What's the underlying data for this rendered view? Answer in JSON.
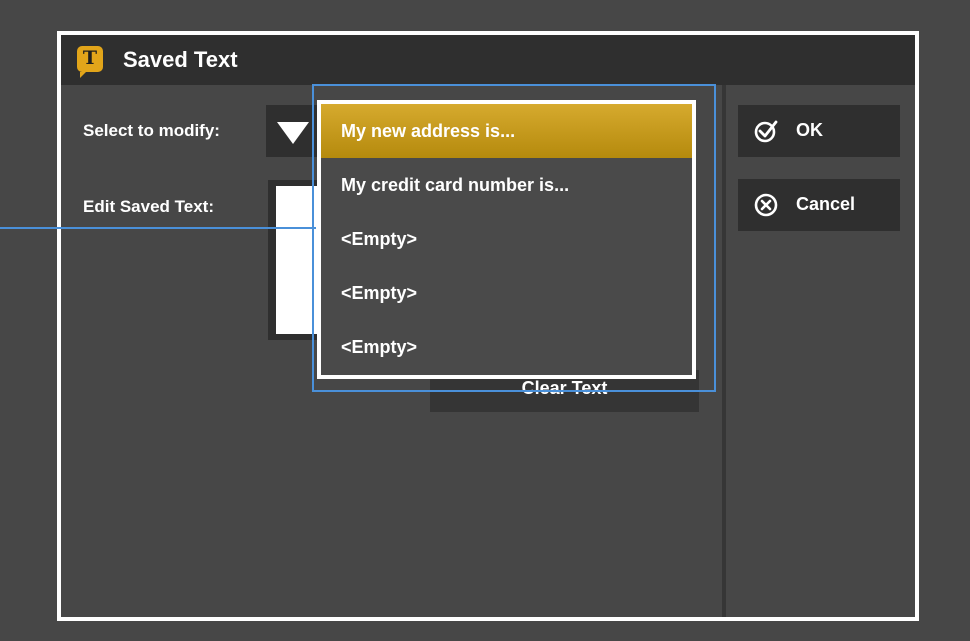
{
  "dialog": {
    "title": "Saved Text",
    "app_icon_letter": "T",
    "select_label": "Select to modify:",
    "edit_label": "Edit Saved Text:",
    "clear_button_label": "Clear Text",
    "ok_label": "OK",
    "cancel_label": "Cancel",
    "accent_color": "#e2a51a"
  },
  "dropdown": {
    "options": [
      "My new address is...",
      "My credit card number is...",
      "<Empty>",
      "<Empty>",
      "<Empty>"
    ],
    "selected_index": 0,
    "highlight_color": "#4a90d9"
  }
}
